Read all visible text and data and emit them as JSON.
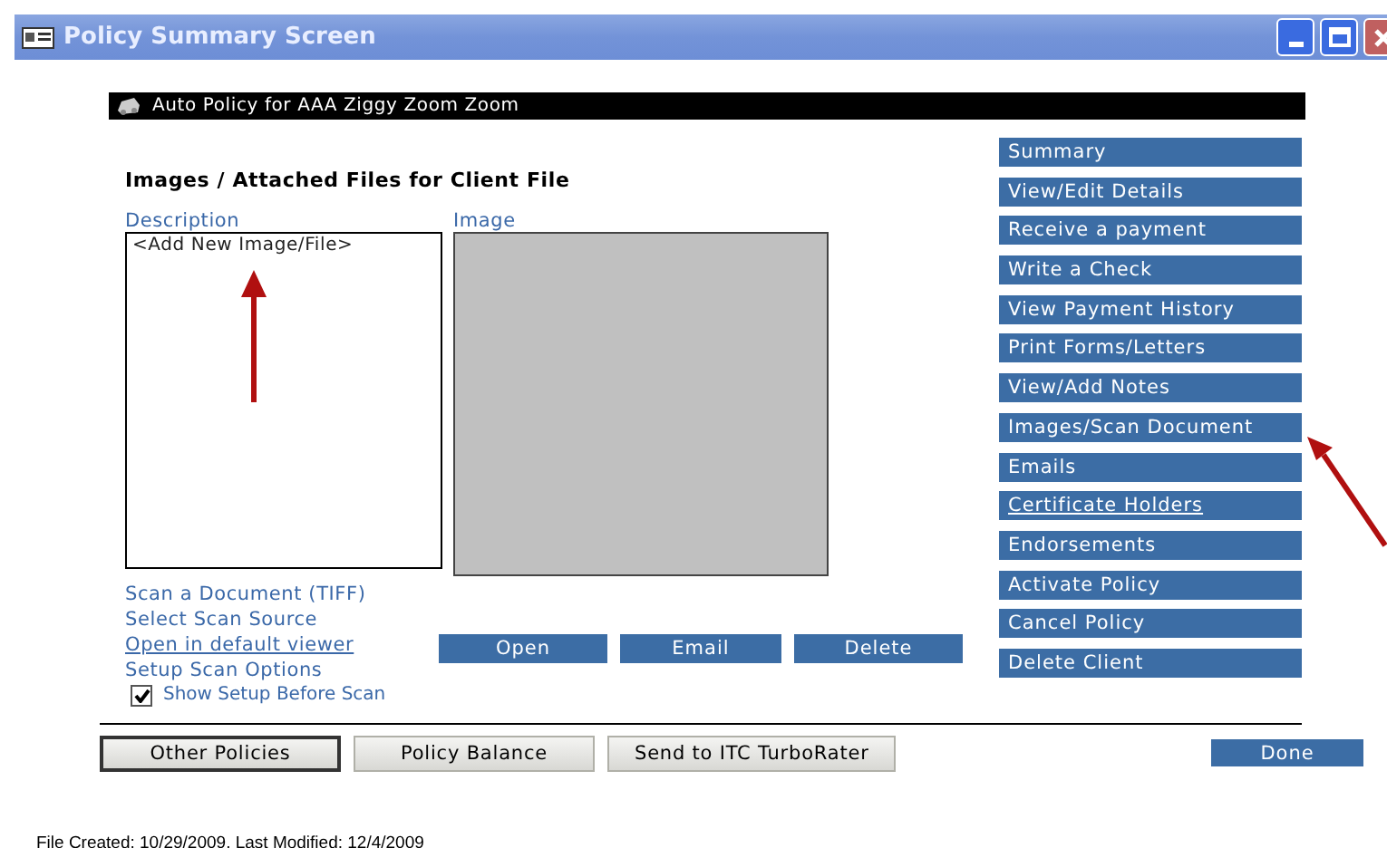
{
  "window": {
    "title": "Policy Summary Screen"
  },
  "policy_bar": {
    "title": "Auto Policy for AAA Ziggy Zoom Zoom"
  },
  "section": {
    "heading": "Images / Attached Files for Client File",
    "description_label": "Description",
    "image_label": "Image"
  },
  "file_list": [
    {
      "label": "<Add New Image/File>"
    }
  ],
  "scan_links": [
    {
      "label": "Scan a Document (TIFF)",
      "underlined": false
    },
    {
      "label": "Select Scan Source",
      "underlined": false
    },
    {
      "label": "Open in default viewer",
      "underlined": true
    },
    {
      "label": "Setup Scan Options",
      "underlined": false
    }
  ],
  "show_setup": {
    "label": "Show Setup Before Scan",
    "checked": true
  },
  "image_buttons": [
    "Open",
    "Email",
    "Delete"
  ],
  "nav": [
    {
      "label": "Summary",
      "underlined": false
    },
    {
      "label": "View/Edit Details",
      "underlined": false
    },
    {
      "label": "Receive a payment",
      "underlined": false
    },
    {
      "label": "Write a Check",
      "underlined": false
    },
    {
      "label": "View Payment History",
      "underlined": false
    },
    {
      "label": "Print Forms/Letters",
      "underlined": false
    },
    {
      "label": "View/Add Notes",
      "underlined": false
    },
    {
      "label": "Images/Scan Document",
      "underlined": false
    },
    {
      "label": "Emails",
      "underlined": false
    },
    {
      "label": "Certificate Holders",
      "underlined": true
    },
    {
      "label": "Endorsements",
      "underlined": false
    },
    {
      "label": "Activate Policy",
      "underlined": false
    },
    {
      "label": "Cancel Policy",
      "underlined": false
    },
    {
      "label": "Delete Client",
      "underlined": false
    }
  ],
  "footer_buttons": [
    {
      "label": "Other Policies",
      "default": true
    },
    {
      "label": "Policy Balance",
      "default": false
    },
    {
      "label": "Send to ITC TurboRater",
      "default": false
    }
  ],
  "done_button": "Done",
  "status": "File Created: 10/29/2009. Last Modified: 12/4/2009"
}
